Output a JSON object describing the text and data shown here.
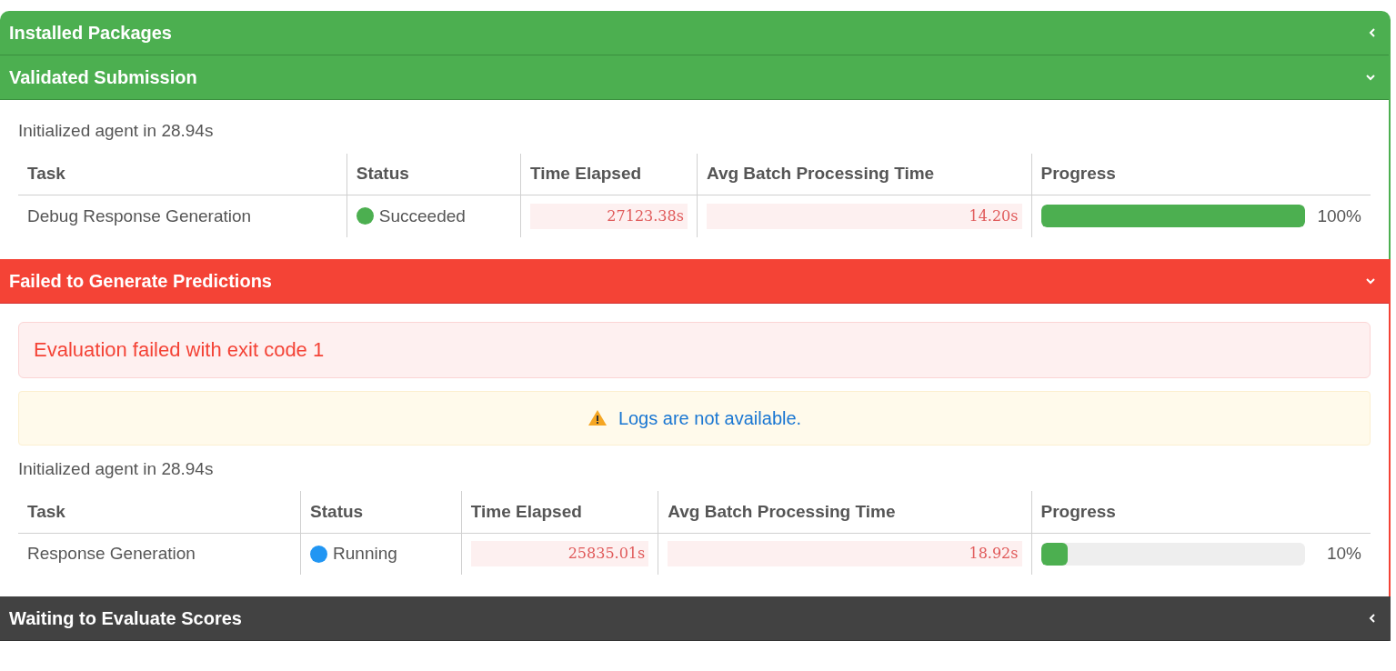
{
  "sections": [
    {
      "kind": "success",
      "title": "Installed Packages",
      "expanded": false
    },
    {
      "kind": "success",
      "title": "Validated Submission",
      "expanded": true,
      "body": {
        "init_text": "Initialized agent in 28.94s",
        "table": {
          "columns": [
            "Task",
            "Status",
            "Time Elapsed",
            "Avg Batch Processing Time",
            "Progress"
          ],
          "rows": [
            {
              "task": "Debug Response Generation",
              "status": "Succeeded",
              "color": "#4caf50",
              "time_elapsed": "27123.38s",
              "avg_batch": "14.20s",
              "level": 1,
              "percent": "100%"
            }
          ]
        }
      }
    },
    {
      "kind": "error",
      "title": "Failed to Generate Predictions",
      "expanded": true,
      "body": {
        "error": "Evaluation failed with exit code 1",
        "warning": "Logs are not available.",
        "init_text": "Initialized agent in 28.94s",
        "table": {
          "columns": [
            "Task",
            "Status",
            "Time Elapsed",
            "Avg Batch Processing Time",
            "Progress"
          ],
          "rows": [
            {
              "task": "Response Generation",
              "status": "Running",
              "color": "#2196f3",
              "time_elapsed": "25835.01s",
              "avg_batch": "18.92s",
              "level": 0.1,
              "percent": "10%"
            }
          ]
        }
      }
    },
    {
      "kind": "pending",
      "title": "Waiting to Evaluate Scores",
      "expanded": false
    }
  ]
}
